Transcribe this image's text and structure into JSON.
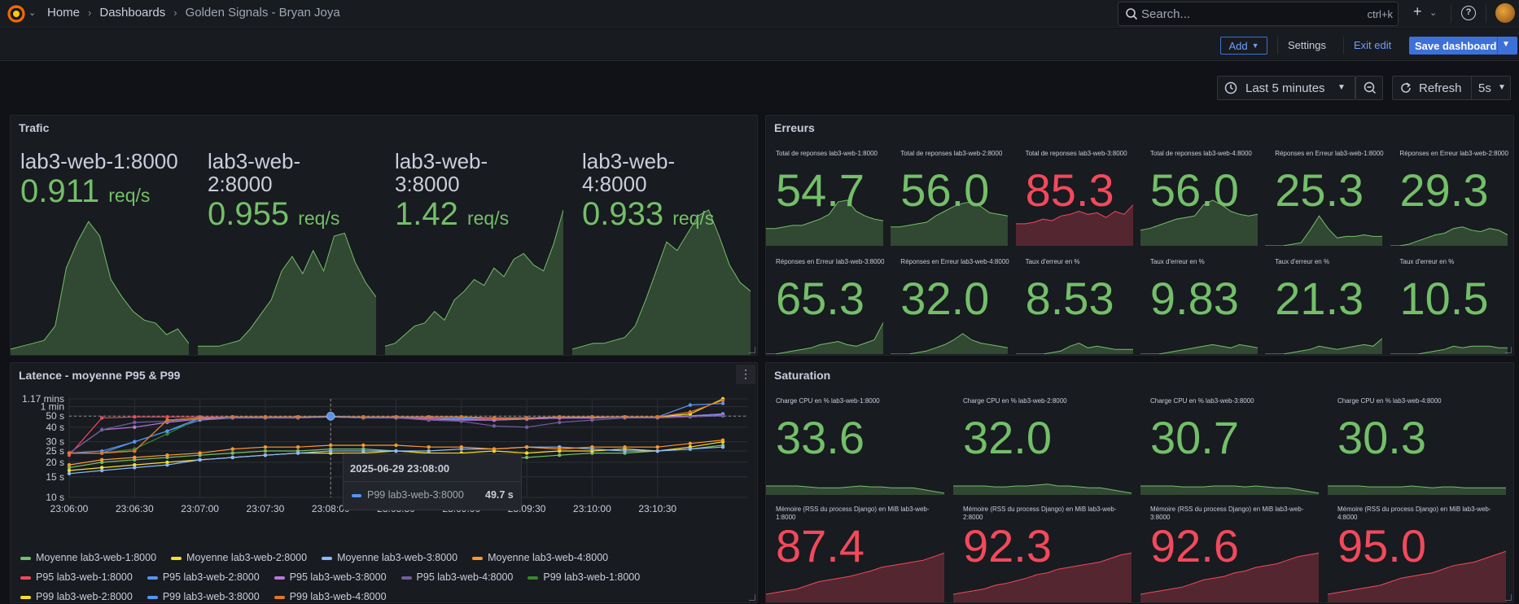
{
  "topbar": {
    "breadcrumb": {
      "home": "Home",
      "dashboards": "Dashboards",
      "current": "Golden Signals - Bryan Joya"
    },
    "search": {
      "placeholder": "Search...",
      "shortcut": "ctrl+k"
    }
  },
  "toolbar": {
    "add_label": "Add",
    "settings_label": "Settings",
    "exit_label": "Exit edit",
    "save_label": "Save dashboard"
  },
  "timepicker": {
    "range": "Last 5 minutes",
    "refresh_label": "Refresh",
    "interval": "5s"
  },
  "colors": {
    "green": "#73bf69",
    "red": "#f2495c",
    "panel": "#181b1f",
    "accent": "#3d71d9"
  },
  "trafic": {
    "title": "Trafic",
    "stats": [
      {
        "name": "lab3-web-1:8000",
        "value": "0.911",
        "unit": "req/s",
        "spark": [
          4,
          6,
          8,
          10,
          20,
          60,
          78,
          92,
          82,
          52,
          40,
          30,
          24,
          22,
          14,
          18,
          8
        ]
      },
      {
        "name": "lab3-web-2:8000",
        "value": "0.955",
        "unit": "req/s",
        "spark": [
          6,
          6,
          6,
          8,
          10,
          18,
          28,
          38,
          58,
          68,
          56,
          72,
          58,
          82,
          84,
          64,
          50,
          40
        ]
      },
      {
        "name": "lab3-web-3:8000",
        "value": "1.42",
        "unit": "req/s",
        "spark": [
          6,
          8,
          14,
          20,
          22,
          30,
          24,
          38,
          44,
          52,
          48,
          60,
          54,
          66,
          70,
          62,
          58,
          76,
          100
        ]
      },
      {
        "name": "lab3-web-4:8000",
        "value": "0.933",
        "unit": "req/s",
        "spark": [
          4,
          6,
          8,
          8,
          10,
          12,
          20,
          38,
          58,
          78,
          72,
          84,
          96,
          100,
          82,
          62,
          50,
          44
        ]
      }
    ]
  },
  "erreurs": {
    "title": "Erreurs",
    "stats": [
      {
        "title": "Total de reponses lab3-web-1:8000",
        "value": "54.7",
        "color": "green",
        "spark": [
          22,
          22,
          24,
          26,
          26,
          30,
          34,
          40,
          56,
          58,
          44,
          38,
          34,
          32
        ]
      },
      {
        "title": "Total de reponses lab3-web-2:8000",
        "value": "56.0",
        "color": "green",
        "spark": [
          24,
          24,
          26,
          28,
          30,
          38,
          44,
          50,
          54,
          56,
          50,
          42,
          40,
          38
        ]
      },
      {
        "title": "Total de reponses lab3-web-3:8000",
        "value": "85.3",
        "color": "red",
        "spark": [
          28,
          28,
          30,
          34,
          32,
          38,
          40,
          44,
          40,
          42,
          36,
          44,
          40,
          52
        ]
      },
      {
        "title": "Total de reponses lab3-web-4:8000",
        "value": "56.0",
        "color": "green",
        "spark": [
          20,
          22,
          26,
          30,
          34,
          36,
          38,
          52,
          58,
          52,
          44,
          40,
          38,
          40
        ]
      },
      {
        "title": "Réponses en Erreur lab3-web-1:8000",
        "value": "25.3",
        "color": "green",
        "spark": [
          0,
          0,
          0,
          2,
          4,
          20,
          38,
          22,
          10,
          12,
          12,
          14,
          12,
          12
        ]
      },
      {
        "title": "Réponses en Erreur lab3-web-2:8000",
        "value": "29.3",
        "color": "green",
        "spark": [
          0,
          0,
          2,
          6,
          10,
          14,
          16,
          22,
          24,
          20,
          18,
          22,
          20,
          14
        ]
      },
      {
        "title": "Réponses en Erreur lab3-web-3:8000",
        "value": "65.3",
        "color": "green",
        "spark": [
          0,
          0,
          2,
          4,
          6,
          8,
          12,
          14,
          16,
          12,
          10,
          14,
          18,
          40
        ]
      },
      {
        "title": "Réponses en Erreur lab3-web-4:8000",
        "value": "32.0",
        "color": "green",
        "spark": [
          0,
          0,
          0,
          2,
          4,
          8,
          12,
          18,
          26,
          18,
          14,
          12,
          10,
          8
        ]
      },
      {
        "title": "Taux d'erreur en %",
        "value": "8.53",
        "color": "green",
        "spark": [
          0,
          0,
          0,
          0,
          2,
          4,
          10,
          14,
          8,
          10,
          8,
          6,
          6,
          6
        ]
      },
      {
        "title": "Taux d'erreur en %",
        "value": "9.83",
        "color": "green",
        "spark": [
          0,
          0,
          0,
          2,
          4,
          6,
          8,
          10,
          12,
          10,
          8,
          12,
          10,
          8
        ]
      },
      {
        "title": "Taux d'erreur en %",
        "value": "21.3",
        "color": "green",
        "spark": [
          0,
          0,
          0,
          2,
          4,
          6,
          10,
          8,
          6,
          8,
          10,
          12,
          10,
          20
        ]
      },
      {
        "title": "Taux d'erreur en %",
        "value": "10.5",
        "color": "green",
        "spark": [
          0,
          0,
          0,
          0,
          2,
          4,
          6,
          10,
          8,
          10,
          10,
          10,
          8,
          8
        ]
      }
    ]
  },
  "latence": {
    "title": "Latence - moyenne P95 & P99",
    "tooltip": {
      "time": "2025-06-29 23:08:00",
      "series": "P99 lab3-web-3:8000",
      "value": "49.7 s"
    },
    "legend": [
      [
        {
          "name": "Moyenne lab3-web-1:8000",
          "color": "#73bf69"
        },
        {
          "name": "Moyenne lab3-web-2:8000",
          "color": "#fade2a"
        },
        {
          "name": "Moyenne lab3-web-3:8000",
          "color": "#8ab8ff"
        },
        {
          "name": "Moyenne lab3-web-4:8000",
          "color": "#ff9830"
        }
      ],
      [
        {
          "name": "P95 lab3-web-1:8000",
          "color": "#f2495c"
        },
        {
          "name": "P95 lab3-web-2:8000",
          "color": "#5794f2"
        },
        {
          "name": "P95 lab3-web-3:8000",
          "color": "#b877d9"
        },
        {
          "name": "P95 lab3-web-4:8000",
          "color": "#705da0"
        },
        {
          "name": "P99 lab3-web-1:8000",
          "color": "#37872d"
        }
      ],
      [
        {
          "name": "P99 lab3-web-2:8000",
          "color": "#fade2a"
        },
        {
          "name": "P99 lab3-web-3:8000",
          "color": "#5794f2"
        },
        {
          "name": "P99 lab3-web-4:8000",
          "color": "#e0752d"
        }
      ]
    ]
  },
  "chart_data": {
    "type": "line",
    "title": "Latence - moyenne P95 & P99",
    "x": [
      "23:06:00",
      "23:06:15",
      "23:06:30",
      "23:06:45",
      "23:07:00",
      "23:07:15",
      "23:07:30",
      "23:07:45",
      "23:08:00",
      "23:08:15",
      "23:08:30",
      "23:08:45",
      "23:09:00",
      "23:09:15",
      "23:09:30",
      "23:09:45",
      "23:10:00",
      "23:10:15",
      "23:10:30",
      "23:10:45",
      "23:10:52"
    ],
    "x_ticks": [
      "23:06:00",
      "23:06:30",
      "23:07:00",
      "23:07:30",
      "23:08:00",
      "23:08:30",
      "23:09:00",
      "23:09:30",
      "23:10:00",
      "23:10:30"
    ],
    "y_ticks": [
      "10 s",
      "15 s",
      "20 s",
      "25 s",
      "30 s",
      "40 s",
      "50 s",
      "1 min",
      "1.17 mins"
    ],
    "y_scale": "log",
    "y_unit": "s",
    "ylim": [
      10,
      70
    ],
    "grid": true,
    "series": [
      {
        "name": "Moyenne lab3-web-1:8000",
        "color": "#73bf69",
        "values": [
          18,
          20,
          21,
          22,
          23,
          24,
          25,
          25,
          26,
          26,
          25,
          24,
          22,
          21,
          22,
          23,
          24,
          24,
          25,
          26,
          28
        ]
      },
      {
        "name": "Moyenne lab3-web-2:8000",
        "color": "#fade2a",
        "values": [
          17,
          18,
          19,
          20,
          21,
          22,
          23,
          24,
          24,
          24,
          25,
          24,
          24,
          25,
          24,
          25,
          25,
          26,
          25,
          27,
          30
        ]
      },
      {
        "name": "Moyenne lab3-web-3:8000",
        "color": "#8ab8ff",
        "values": [
          16,
          17,
          18,
          19,
          21,
          22,
          23,
          24,
          25,
          25,
          25,
          25,
          26,
          26,
          27,
          27,
          26,
          25,
          25,
          26,
          27
        ]
      },
      {
        "name": "Moyenne lab3-web-4:8000",
        "color": "#ff9830",
        "values": [
          19,
          21,
          22,
          23,
          24,
          26,
          27,
          27,
          28,
          28,
          28,
          27,
          27,
          26,
          27,
          26,
          27,
          27,
          27,
          29,
          31
        ]
      },
      {
        "name": "P95 lab3-web-1:8000",
        "color": "#f2495c",
        "values": [
          23,
          48,
          49,
          49,
          49,
          49,
          49,
          49,
          49,
          48,
          49,
          48,
          47,
          47,
          47,
          48,
          48,
          49,
          49,
          50,
          52
        ]
      },
      {
        "name": "P95 lab3-web-2:8000",
        "color": "#5794f2",
        "values": [
          24,
          25,
          30,
          37,
          46,
          48,
          49,
          49,
          49,
          48,
          48,
          47,
          47,
          46,
          47,
          48,
          48,
          49,
          49,
          50,
          52
        ]
      },
      {
        "name": "P95 lab3-web-3:8000",
        "color": "#b877d9",
        "values": [
          24,
          38,
          40,
          44,
          47,
          48,
          48,
          48,
          49,
          49,
          48,
          47,
          46,
          46,
          47,
          48,
          48,
          49,
          49,
          50,
          51
        ]
      },
      {
        "name": "P95 lab3-web-4:8000",
        "color": "#705da0",
        "values": [
          24,
          38,
          44,
          45,
          48,
          48,
          48,
          48,
          49,
          48,
          48,
          46,
          45,
          41,
          40,
          44,
          46,
          48,
          48,
          49,
          50
        ]
      },
      {
        "name": "P99 lab3-web-1:8000",
        "color": "#37872d",
        "values": [
          24,
          24,
          26,
          35,
          48,
          49,
          49,
          49,
          49,
          49,
          49,
          49,
          49,
          48,
          48,
          49,
          49,
          49,
          49,
          52,
          80
        ]
      },
      {
        "name": "P99 lab3-web-2:8000",
        "color": "#fade2a",
        "values": [
          24,
          24,
          25,
          46,
          48,
          49,
          49,
          49,
          49,
          49,
          49,
          49,
          49,
          48,
          48,
          49,
          49,
          49,
          49,
          52,
          75
        ]
      },
      {
        "name": "P99 lab3-web-3:8000",
        "color": "#5794f2",
        "values": [
          24,
          24,
          30,
          37,
          48,
          49,
          49,
          49,
          49.7,
          49,
          49,
          49,
          48,
          48,
          48,
          49,
          49,
          49,
          49,
          62,
          64
        ]
      },
      {
        "name": "P99 lab3-web-4:8000",
        "color": "#e0752d",
        "values": [
          24,
          24,
          25,
          46,
          48,
          49,
          49,
          49,
          49,
          49,
          49,
          49,
          49,
          48,
          48,
          49,
          49,
          49,
          49,
          54,
          68
        ]
      }
    ]
  },
  "saturation": {
    "title": "Saturation",
    "stats": [
      {
        "title": "Charge CPU en % lab3-web-1:8000",
        "value": "33.6",
        "color": "green",
        "spark": [
          10,
          10,
          10,
          10,
          9,
          8,
          8,
          8,
          9,
          10,
          9,
          9,
          8,
          8,
          8,
          6,
          4,
          2
        ]
      },
      {
        "title": "Charge CPU en % lab3-web-2:8000",
        "value": "32.0",
        "color": "green",
        "spark": [
          10,
          10,
          10,
          10,
          9,
          9,
          10,
          10,
          11,
          12,
          10,
          10,
          9,
          8,
          8,
          6,
          4,
          2
        ]
      },
      {
        "title": "Charge CPU en % lab3-web-3:8000",
        "value": "30.7",
        "color": "green",
        "spark": [
          10,
          10,
          10,
          10,
          9,
          9,
          9,
          10,
          10,
          10,
          9,
          10,
          9,
          8,
          8,
          6,
          4,
          2
        ]
      },
      {
        "title": "Charge CPU en % lab3-web-4:8000",
        "value": "30.3",
        "color": "green",
        "spark": [
          10,
          10,
          10,
          10,
          9,
          9,
          9,
          9,
          10,
          9,
          8,
          9,
          9,
          8,
          8,
          8,
          8,
          8
        ]
      },
      {
        "title": "Mémoire (RSS du process Django) en MiB lab3-web-1:8000",
        "value": "87.4",
        "color": "red",
        "spark": [
          10,
          12,
          14,
          16,
          20,
          24,
          26,
          28,
          30,
          33,
          36,
          40,
          42,
          44,
          46,
          48,
          52,
          56
        ]
      },
      {
        "title": "Mémoire (RSS du process Django) en MiB lab3-web-2:8000",
        "value": "92.3",
        "color": "red",
        "spark": [
          10,
          12,
          14,
          16,
          20,
          22,
          25,
          28,
          32,
          34,
          38,
          40,
          42,
          44,
          46,
          50,
          54,
          56
        ]
      },
      {
        "title": "Mémoire (RSS du process Django) en MiB lab3-web-3:8000",
        "value": "92.6",
        "color": "red",
        "spark": [
          10,
          12,
          14,
          16,
          18,
          22,
          26,
          28,
          30,
          34,
          36,
          40,
          42,
          44,
          48,
          52,
          54,
          56
        ]
      },
      {
        "title": "Mémoire (RSS du process Django) en MiB lab3-web-4:8000",
        "value": "95.0",
        "color": "red",
        "spark": [
          10,
          12,
          14,
          16,
          18,
          20,
          24,
          28,
          30,
          32,
          34,
          38,
          42,
          44,
          46,
          50,
          54,
          58
        ]
      }
    ]
  }
}
